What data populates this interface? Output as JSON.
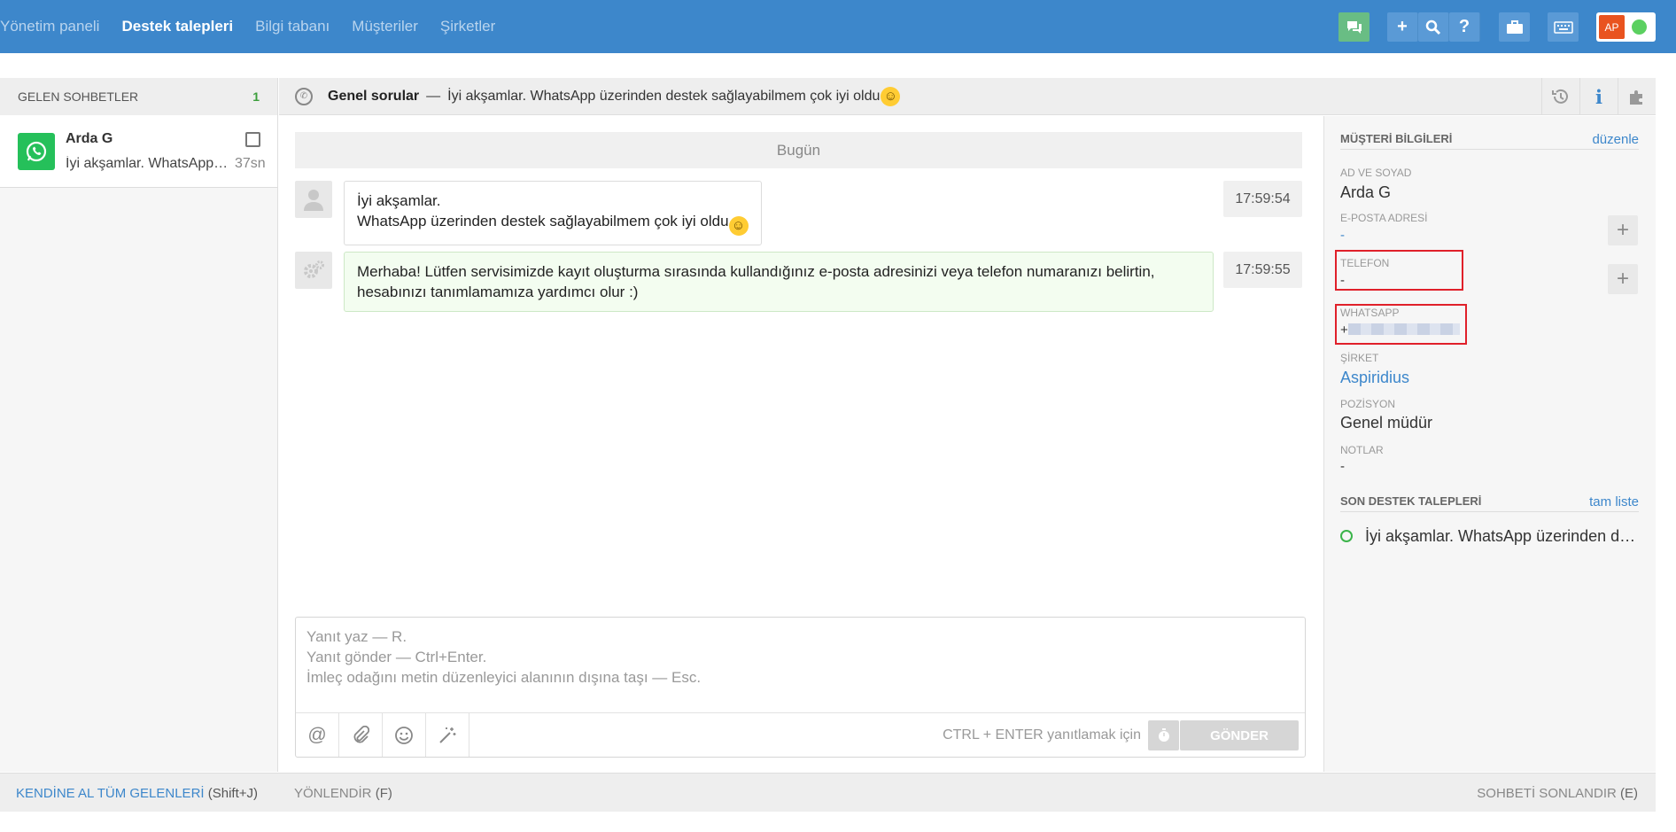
{
  "nav": {
    "items": [
      "Yönetim paneli",
      "Destek talepleri",
      "Bilgi tabanı",
      "Müşteriler",
      "Şirketler"
    ],
    "active_index": 1
  },
  "toolbar": {
    "user_initials": "AP",
    "status_color": "#5bd060"
  },
  "inbox": {
    "title": "GELEN SOHBETLER",
    "count": "1",
    "chats": [
      {
        "name": "Arda G",
        "preview": "İyi akşamlar. WhatsApp üzerinden destek sağlayabilmem çok iyi oldu",
        "time": "37sn",
        "channel": "whatsapp-icon"
      }
    ]
  },
  "conversation": {
    "topic": "Genel sorular",
    "separator": "—",
    "subject": "İyi akşamlar. WhatsApp üzerinden destek sağlayabilmem çok iyi oldu",
    "day_label": "Bugün",
    "messages": [
      {
        "line1": "İyi akşamlar.",
        "line2": "WhatsApp üzerinden destek sağlayabilmem çok iyi oldu",
        "time": "17:59:54",
        "sender": "customer"
      },
      {
        "line1": "Merhaba! Lütfen servisimizde kayıt oluşturma sırasında kullandığınız e-posta adresinizi veya telefon numaranızı belirtin,",
        "line2": "hesabınızı tanımlamamıza yardımcı olur :)",
        "time": "17:59:55",
        "sender": "system"
      }
    ]
  },
  "reply": {
    "hint1": "Yanıt yaz — R.",
    "hint2": "Yanıt gönder — Ctrl+Enter.",
    "hint3": "İmleç odağını metin düzenleyici alanının dışına taşı — Esc.",
    "send_hint": "CTRL + ENTER yanıtlamak için",
    "send_label": "GÖNDER"
  },
  "customer": {
    "section_title": "MÜŞTERİ BİLGİLERİ",
    "edit_label": "düzenle",
    "name_label": "AD VE SOYAD",
    "name": "Arda G",
    "email_label": "E-POSTA ADRESİ",
    "email": "-",
    "phone_label": "TELEFON",
    "phone": "-",
    "whatsapp_label": "WHATSAPP",
    "whatsapp_prefix": "+",
    "company_label": "ŞİRKET",
    "company": "Aspiridius",
    "position_label": "POZİSYON",
    "position": "Genel müdür",
    "notes_label": "NOTLAR",
    "notes": "-"
  },
  "recent_tickets": {
    "title": "SON DESTEK TALEPLERİ",
    "link": "tam liste",
    "items": [
      "İyi akşamlar. WhatsApp üzerinden destek sağlayabilmem çok iyi oldu"
    ]
  },
  "footer": {
    "take_all": "KENDİNE AL TÜM GELENLERİ",
    "take_all_key": "(Shift+J)",
    "route": "YÖNLENDİR",
    "route_key": "(F)",
    "end": "SOHBETİ SONLANDIR",
    "end_key": "(E)"
  }
}
